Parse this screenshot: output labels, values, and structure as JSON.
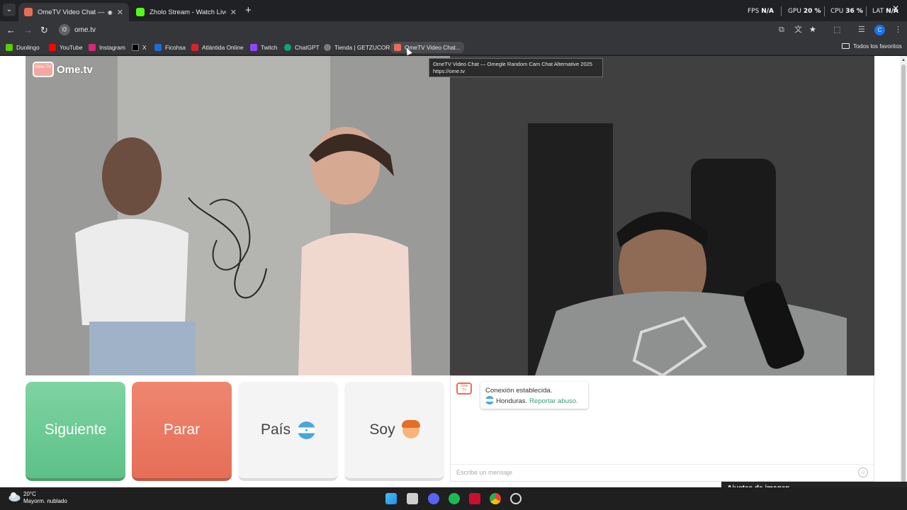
{
  "browser": {
    "tabs": [
      {
        "title": "OmeTV Video Chat — Ome",
        "active": true
      },
      {
        "title": "Zholo Stream - Watch Live on K",
        "active": false
      }
    ],
    "perf": {
      "fps_label": "FPS",
      "fps_value": "N/A",
      "gpu_label": "GPU",
      "gpu_value": "20 %",
      "cpu_label": "CPU",
      "cpu_value": "36 %",
      "lat_label": "LAT",
      "lat_value": "N/A"
    },
    "url": "ome.tv",
    "profile_initial": "C",
    "bookmarks": [
      {
        "label": "Duolingo",
        "color": "#58cc02"
      },
      {
        "label": "YouTube",
        "color": "#ff0000"
      },
      {
        "label": "Instagram",
        "color": "#d62976"
      },
      {
        "label": "X",
        "color": "#000000"
      },
      {
        "label": "Ficohsa",
        "color": "#1e6bd6"
      },
      {
        "label": "Atlántida Online",
        "color": "#d7242a"
      },
      {
        "label": "Twitch",
        "color": "#9146ff"
      },
      {
        "label": "ChatGPT",
        "color": "#10a37f"
      },
      {
        "label": "Tienda | GETZUCORE",
        "color": "#7a7a7a"
      },
      {
        "label": "OmeTV Video Chat...",
        "color": "#e66e57"
      }
    ],
    "all_bookmarks_label": "Todos los favoritos",
    "tooltip": {
      "title": "OmeTV Video Chat — Omegle Random Cam Chat Alternative 2025",
      "url": "https://ome.tv"
    }
  },
  "app": {
    "logo_text": "Ome.tv",
    "logo_badge": "Ome TV",
    "buttons": {
      "next": "Siguiente",
      "stop": "Parar",
      "country": "País",
      "gender": "Soy"
    },
    "chat": {
      "connection": "Conexión establecida.",
      "country": "Honduras.",
      "report": "Reportar abuso.",
      "placeholder": "Escribe un mensaje"
    },
    "image_settings": "Ajustes de imagen"
  },
  "taskbar": {
    "temperature": "20°C",
    "weather": "Mayorm. nublado"
  }
}
